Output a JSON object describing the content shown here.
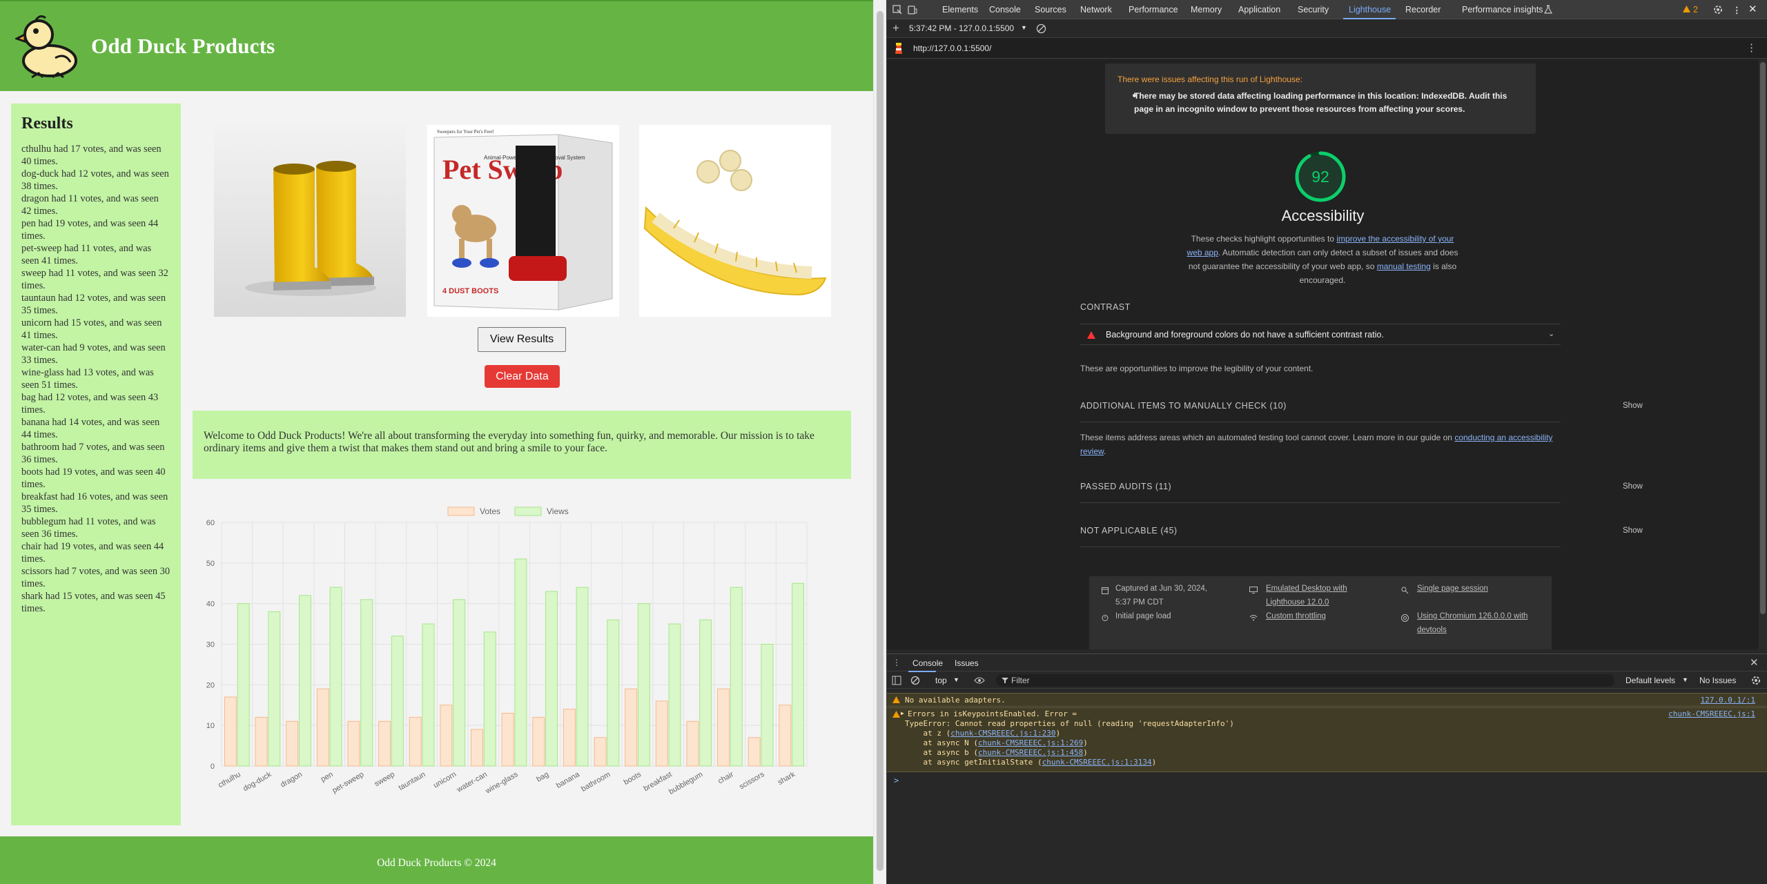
{
  "site": {
    "title": "Odd Duck Products",
    "results_title": "Results",
    "results": [
      "cthulhu had 17 votes, and was seen 40 times.",
      "dog-duck had 12 votes, and was seen 38 times.",
      "dragon had 11 votes, and was seen 42 times.",
      "pen had 19 votes, and was seen 44 times.",
      "pet-sweep had 11 votes, and was seen 41 times.",
      "sweep had 11 votes, and was seen 32 times.",
      "tauntaun had 12 votes, and was seen 35 times.",
      "unicorn had 15 votes, and was seen 41 times.",
      "water-can had 9 votes, and was seen 33 times.",
      "wine-glass had 13 votes, and was seen 51 times.",
      "bag had 12 votes, and was seen 43 times.",
      "banana had 14 votes, and was seen 44 times.",
      "bathroom had 7 votes, and was seen 36 times.",
      "boots had 19 votes, and was seen 40 times.",
      "breakfast had 16 votes, and was seen 35 times.",
      "bubblegum had 11 votes, and was seen 36 times.",
      "chair had 19 votes, and was seen 44 times.",
      "scissors had 7 votes, and was seen 30 times.",
      "shark had 15 votes, and was seen 45 times."
    ],
    "product_box_text": {
      "top_caption": "Sweepers for Your Pet's Feet!",
      "brand": "Pet Sweep",
      "tagline": "Animal-Powered Debris Removal System",
      "count": "4 DUST BOOTS"
    },
    "view_results_label": "View Results",
    "clear_data_label": "Clear Data",
    "welcome": "Welcome to Odd Duck Products! We're all about transforming the everyday into something fun, quirky, and memorable. Our mission is to take ordinary items and give them a twist that makes them stand out and bring a smile to your face.",
    "footer": "Odd Duck Products © 2024",
    "colors": {
      "header": "#66b544",
      "panel": "#c2f4a4",
      "clear_button": "#e53935"
    }
  },
  "chart_data": {
    "type": "bar",
    "categories": [
      "cthulhu",
      "dog-duck",
      "dragon",
      "pen",
      "pet-sweep",
      "sweep",
      "tauntaun",
      "unicorn",
      "water-can",
      "wine-glass",
      "bag",
      "banana",
      "bathroom",
      "boots",
      "breakfast",
      "bubblegum",
      "chair",
      "scissors",
      "shark"
    ],
    "series": [
      {
        "name": "Votes",
        "values": [
          17,
          12,
          11,
          19,
          11,
          11,
          12,
          15,
          9,
          13,
          12,
          14,
          7,
          19,
          16,
          11,
          19,
          7,
          15
        ],
        "fill": "#fde4cf",
        "stroke": "#f4b98c"
      },
      {
        "name": "Views",
        "values": [
          40,
          38,
          42,
          44,
          41,
          32,
          35,
          41,
          33,
          51,
          43,
          44,
          36,
          40,
          35,
          36,
          44,
          30,
          45
        ],
        "fill": "#d9f7c8",
        "stroke": "#a6e68a"
      }
    ],
    "yticks": [
      "0",
      "10",
      "20",
      "30",
      "40",
      "50",
      "60"
    ],
    "ylim": [
      0,
      60
    ],
    "grid": true,
    "legend": "top-center"
  },
  "devtools": {
    "tabs": [
      "Elements",
      "Console",
      "Sources",
      "Network",
      "Performance",
      "Memory",
      "Application",
      "Security",
      "Lighthouse",
      "Recorder",
      "Performance insights"
    ],
    "active_tab": "Lighthouse",
    "issues_count": "2",
    "report_selector": "5:37:42 PM - 127.0.0.1:5500",
    "url": "http://127.0.0.1:5500/",
    "warning_title": "There were issues affecting this run of Lighthouse:",
    "warning_item": "There may be stored data affecting loading performance in this location: IndexedDB. Audit this page in an incognito window to prevent those resources from affecting your scores.",
    "score": "92",
    "score_color": "#0cce6b",
    "category_title": "Accessibility",
    "desc_1": "These checks highlight opportunities to ",
    "desc_link_1": "improve the accessibility of your web app",
    "desc_2": ". Automatic detection can only detect a subset of issues and does not guarantee the accessibility of your web app, so ",
    "desc_link_2": "manual testing",
    "desc_3": " is also encouraged.",
    "group_contrast": "CONTRAST",
    "audit_contrast": "Background and foreground colors do not have a sufficient contrast ratio.",
    "contrast_note": "These are opportunities to improve the legibility of your content.",
    "group_manual": "ADDITIONAL ITEMS TO MANUALLY CHECK (10)",
    "manual_note_1": "These items address areas which an automated testing tool cannot cover. Learn more in our guide on ",
    "manual_note_link": "conducting an accessibility review",
    "manual_note_2": ".",
    "group_passed": "PASSED AUDITS (11)",
    "group_na": "NOT APPLICABLE (45)",
    "show_label": "Show",
    "footer": {
      "captured": "Captured at Jun 30, 2024, 5:37 PM CDT",
      "initial": "Initial page load",
      "emulated": "Emulated Desktop with Lighthouse 12.0.0",
      "throttling": "Custom throttling",
      "session": "Single page session",
      "chromium": "Using Chromium 126.0.0.0 with devtools"
    },
    "drawer_tabs": [
      "Console",
      "Issues"
    ],
    "context": "top",
    "filter_placeholder": "Filter",
    "levels": "Default levels",
    "no_issues": "No Issues",
    "console": {
      "msg1": "No available adapters.",
      "msg1_src": "127.0.0.1/:1",
      "msg2_head": "Errors in isKeypointsEnabled. Error =",
      "msg2_src": "chunk-CMSREEEC.js:1",
      "msg2_l2": "TypeError: Cannot read properties of null (reading 'requestAdapterInfo')",
      "l3_pre": "    at z (",
      "l3_link": "chunk-CMSREEEC.js:1:230",
      "l4_pre": "    at async N (",
      "l4_link": "chunk-CMSREEEC.js:1:269",
      "l5_pre": "    at async b (",
      "l5_link": "chunk-CMSREEEC.js:1:458",
      "l6_pre": "    at async getInitialState (",
      "l6_link": "chunk-CMSREEEC.js:1:3134",
      "close_paren": ")",
      "prompt": ">"
    }
  }
}
